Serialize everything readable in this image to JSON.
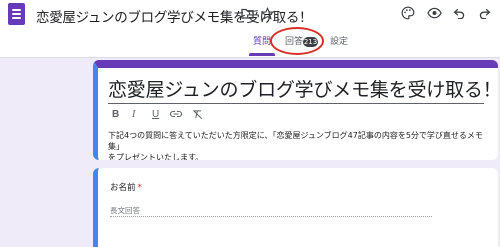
{
  "header": {
    "app_icon": "google-forms-icon",
    "form_title": "恋愛屋ジュンのブログ学びメモ集を受け取る！",
    "icons": [
      "folder-icon",
      "star-icon",
      "palette-icon",
      "eye-icon",
      "undo-icon",
      "redo-icon"
    ]
  },
  "tabs": {
    "questions": "質問",
    "responses": "回答",
    "responses_count": "213",
    "settings": "設定"
  },
  "colors": {
    "accent": "#673ab7",
    "focus_border": "#4285f4",
    "annotation": "#d93025"
  },
  "form": {
    "title": "恋愛屋ジュンのブログ学びメモ集を受け取る！",
    "toolbar": {
      "bold": "B",
      "italic": "I",
      "underline": "U",
      "link_icon": "link-icon",
      "clear_format_icon": "clear-format-icon"
    },
    "description_line1": "下記4つの質問に答えていただいた方限定に、「恋愛屋ジュンブログ47記事の内容を5分で学び直せるメモ集」",
    "description_line2": "をプレゼントいたします。"
  },
  "question": {
    "label": "お名前",
    "required_mark": "*",
    "placeholder": "長文回答"
  }
}
